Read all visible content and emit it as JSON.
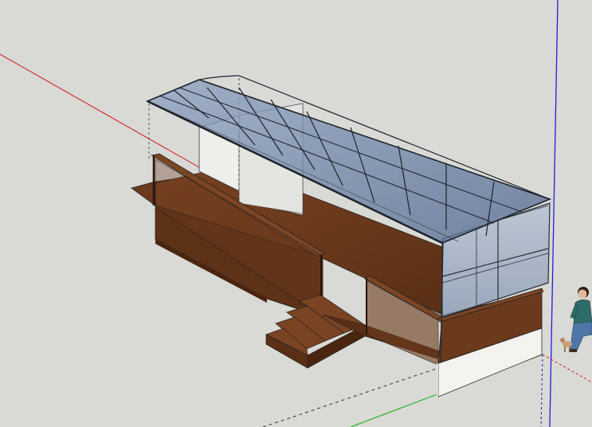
{
  "app": {
    "canvas_background": "#d9d9d5"
  },
  "axes": {
    "red": "#d01818",
    "green": "#10b010",
    "blue": "#2020d0"
  },
  "model": {
    "deck_color": "#6b3a1c",
    "deck_dark": "#4a2510",
    "glass_color": "#6f86a8",
    "frame_color": "#2a2e36",
    "wall_color": "#f2f2ef",
    "figure_shirt": "#2e6e6a",
    "figure_pants": "#4f78a8"
  }
}
